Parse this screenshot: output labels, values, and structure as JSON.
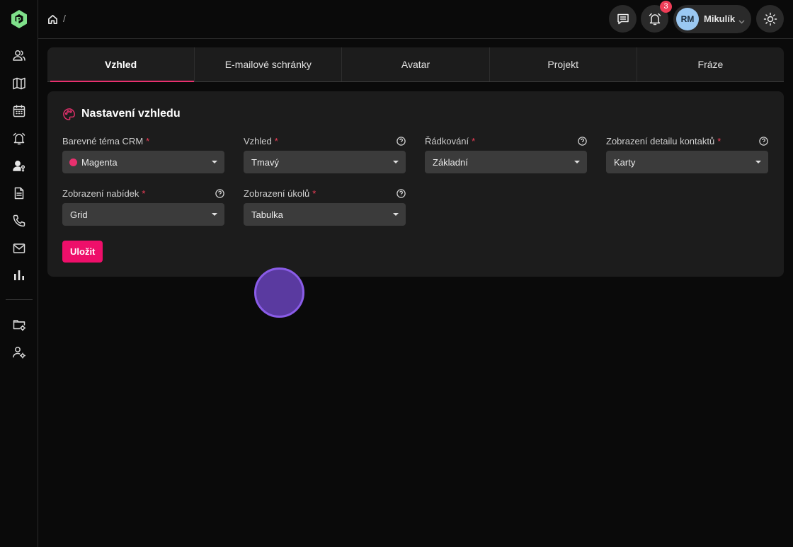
{
  "breadcrumb": {
    "separator": "/"
  },
  "header": {
    "notification_count": "3",
    "user": {
      "initials": "RM",
      "name": "Mikulík"
    }
  },
  "tabs": [
    {
      "label": "Vzhled",
      "active": true
    },
    {
      "label": "E-mailové schránky",
      "active": false
    },
    {
      "label": "Avatar",
      "active": false
    },
    {
      "label": "Projekt",
      "active": false
    },
    {
      "label": "Fráze",
      "active": false
    }
  ],
  "card": {
    "title": "Nastavení vzhledu",
    "fields": [
      {
        "label": "Barevné téma CRM",
        "value": "Magenta",
        "required": "*"
      },
      {
        "label": "Vzhled",
        "value": "Tmavý",
        "required": "*"
      },
      {
        "label": "Řádkování",
        "value": "Základní",
        "required": "*"
      },
      {
        "label": "Zobrazení detailu kontaktů",
        "value": "Karty",
        "required": "*"
      },
      {
        "label": "Zobrazení nabídek",
        "value": "Grid",
        "required": "*"
      },
      {
        "label": "Zobrazení úkolů",
        "value": "Tabulka",
        "required": "*"
      }
    ],
    "save_label": "Uložit"
  },
  "colors": {
    "accent": "#ee0f6a",
    "theme_dot": "#e8306e",
    "badge": "#ef3d57",
    "avatar": "#9ac8f2"
  }
}
